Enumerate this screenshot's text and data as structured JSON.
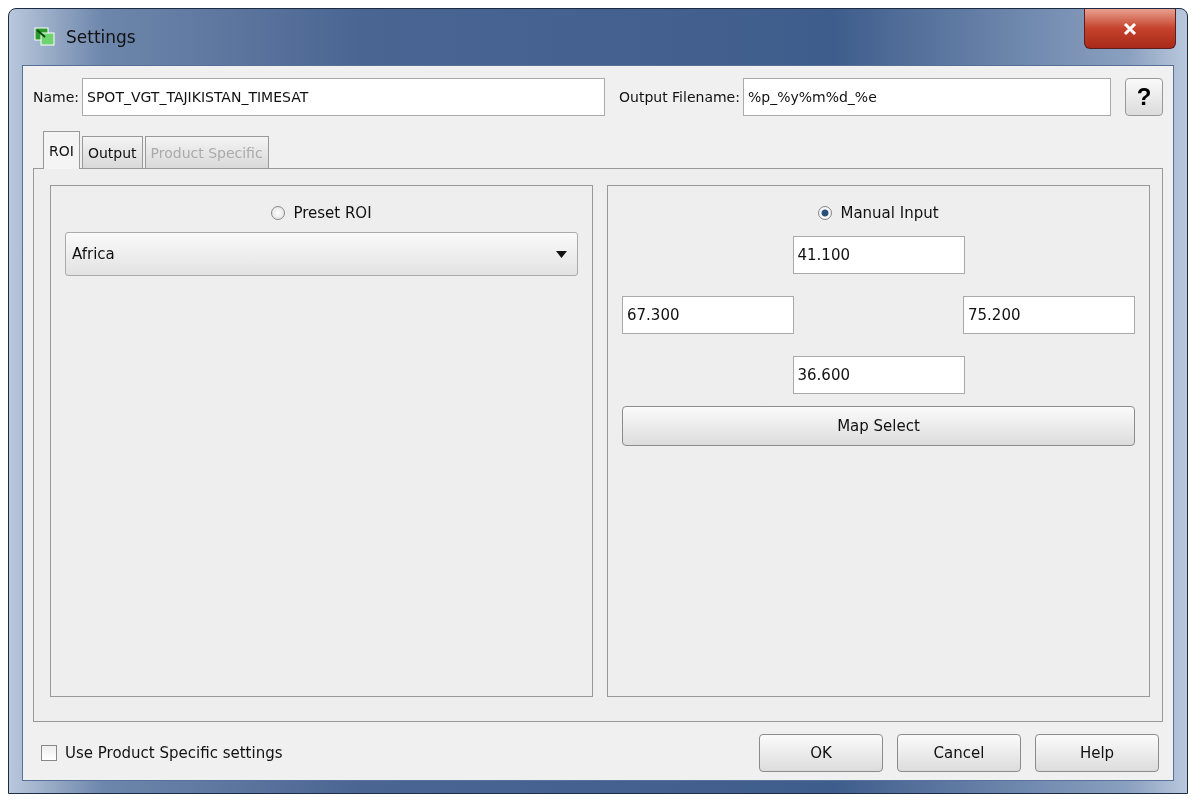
{
  "window": {
    "title": "Settings"
  },
  "name_field": {
    "label": "Name:",
    "value": "SPOT_VGT_TAJIKISTAN_TIMESAT"
  },
  "output_filename_field": {
    "label": "Output Filename:",
    "value": "%p_%y%m%d_%e"
  },
  "help_icon_button": {
    "label": "?"
  },
  "tabs": [
    {
      "label": "ROI",
      "selected": true,
      "disabled": false
    },
    {
      "label": "Output",
      "selected": false,
      "disabled": false
    },
    {
      "label": "Product Specific",
      "selected": false,
      "disabled": true
    }
  ],
  "preset_roi": {
    "label": "Preset ROI",
    "selected": false,
    "dropdown_value": "Africa"
  },
  "manual_input": {
    "label": "Manual Input",
    "selected": true,
    "north": "41.100",
    "west": "67.300",
    "east": "75.200",
    "south": "36.600",
    "map_button": "Map Select"
  },
  "use_product_specific": {
    "label": "Use Product Specific settings",
    "checked": false
  },
  "buttons": [
    "OK",
    "Cancel",
    "Help"
  ]
}
